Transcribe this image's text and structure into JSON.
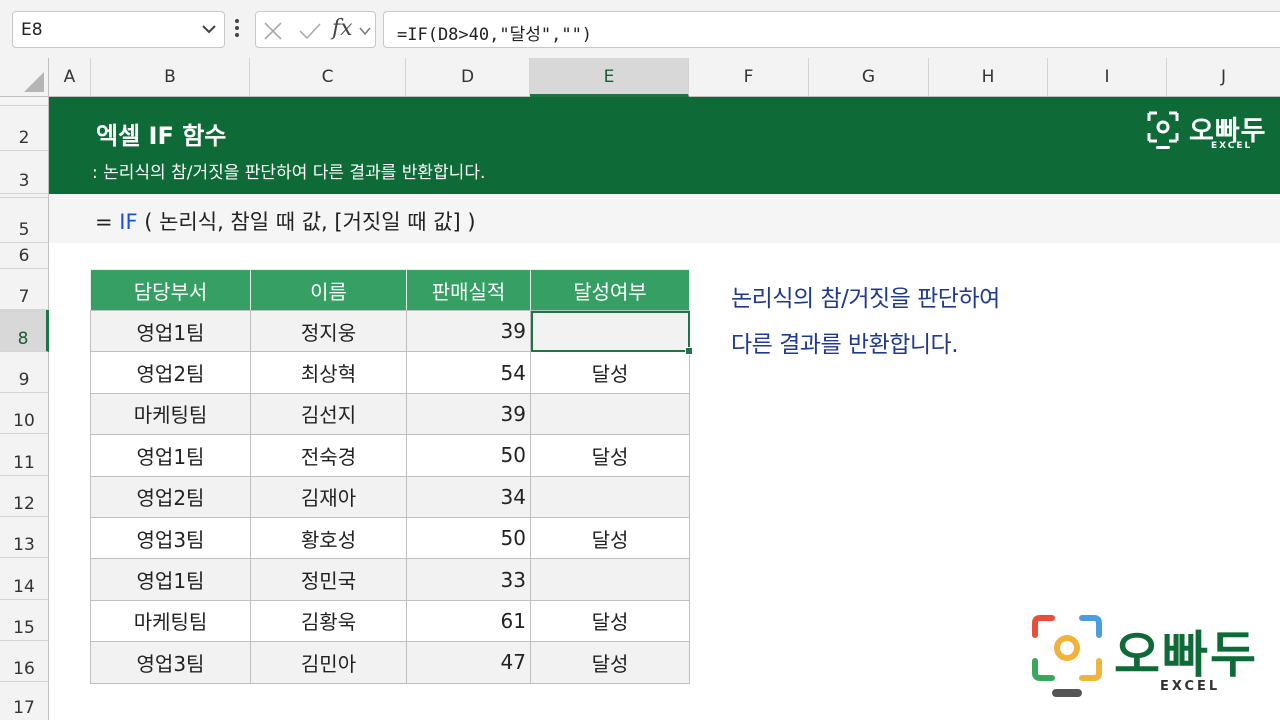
{
  "formula_bar": {
    "name_box": "E8",
    "fx_label": "fx",
    "formula": "=IF(D8>40,\"달성\",\"\")"
  },
  "columns": [
    "A",
    "B",
    "C",
    "D",
    "E",
    "F",
    "G",
    "H",
    "I",
    "J"
  ],
  "selected_column": "E",
  "rows": [
    "2",
    "3",
    "5",
    "6",
    "7",
    "8",
    "9",
    "10",
    "11",
    "12",
    "13",
    "14",
    "15",
    "16",
    "17"
  ],
  "selected_row": "8",
  "banner": {
    "title": "엑셀 IF 함수",
    "subtitle": ": 논리식의 참/거짓을 판단하여 다른 결과를 반환합니다.",
    "logo_text": "오빠두",
    "logo_sub": "EXCEL"
  },
  "syntax": {
    "prefix": "= ",
    "function": "IF",
    "args": " ( 논리식, 참일 때 값, [거짓일 때 값] )"
  },
  "table": {
    "headers": [
      "담당부서",
      "이름",
      "판매실적",
      "달성여부"
    ],
    "rows": [
      [
        "영업1팀",
        "정지웅",
        "39",
        ""
      ],
      [
        "영업2팀",
        "최상혁",
        "54",
        "달성"
      ],
      [
        "마케팅팀",
        "김선지",
        "39",
        ""
      ],
      [
        "영업1팀",
        "전숙경",
        "50",
        "달성"
      ],
      [
        "영업2팀",
        "김재아",
        "34",
        ""
      ],
      [
        "영업3팀",
        "황호성",
        "50",
        "달성"
      ],
      [
        "영업1팀",
        "정민국",
        "33",
        ""
      ],
      [
        "마케팅팀",
        "김황욱",
        "61",
        "달성"
      ],
      [
        "영업3팀",
        "김민아",
        "47",
        "달성"
      ]
    ]
  },
  "description": {
    "line1": "논리식의 참/거짓을 판단하여",
    "line2": "다른 결과를 반환합니다."
  },
  "watermark": {
    "logo_text": "오빠두",
    "logo_sub": "EXCEL"
  },
  "colors": {
    "excel_green": "#217346",
    "banner_green": "#0e6b37",
    "header_green": "#36a064",
    "function_blue": "#1c4ee0",
    "desc_navy": "#1f3a8f"
  }
}
